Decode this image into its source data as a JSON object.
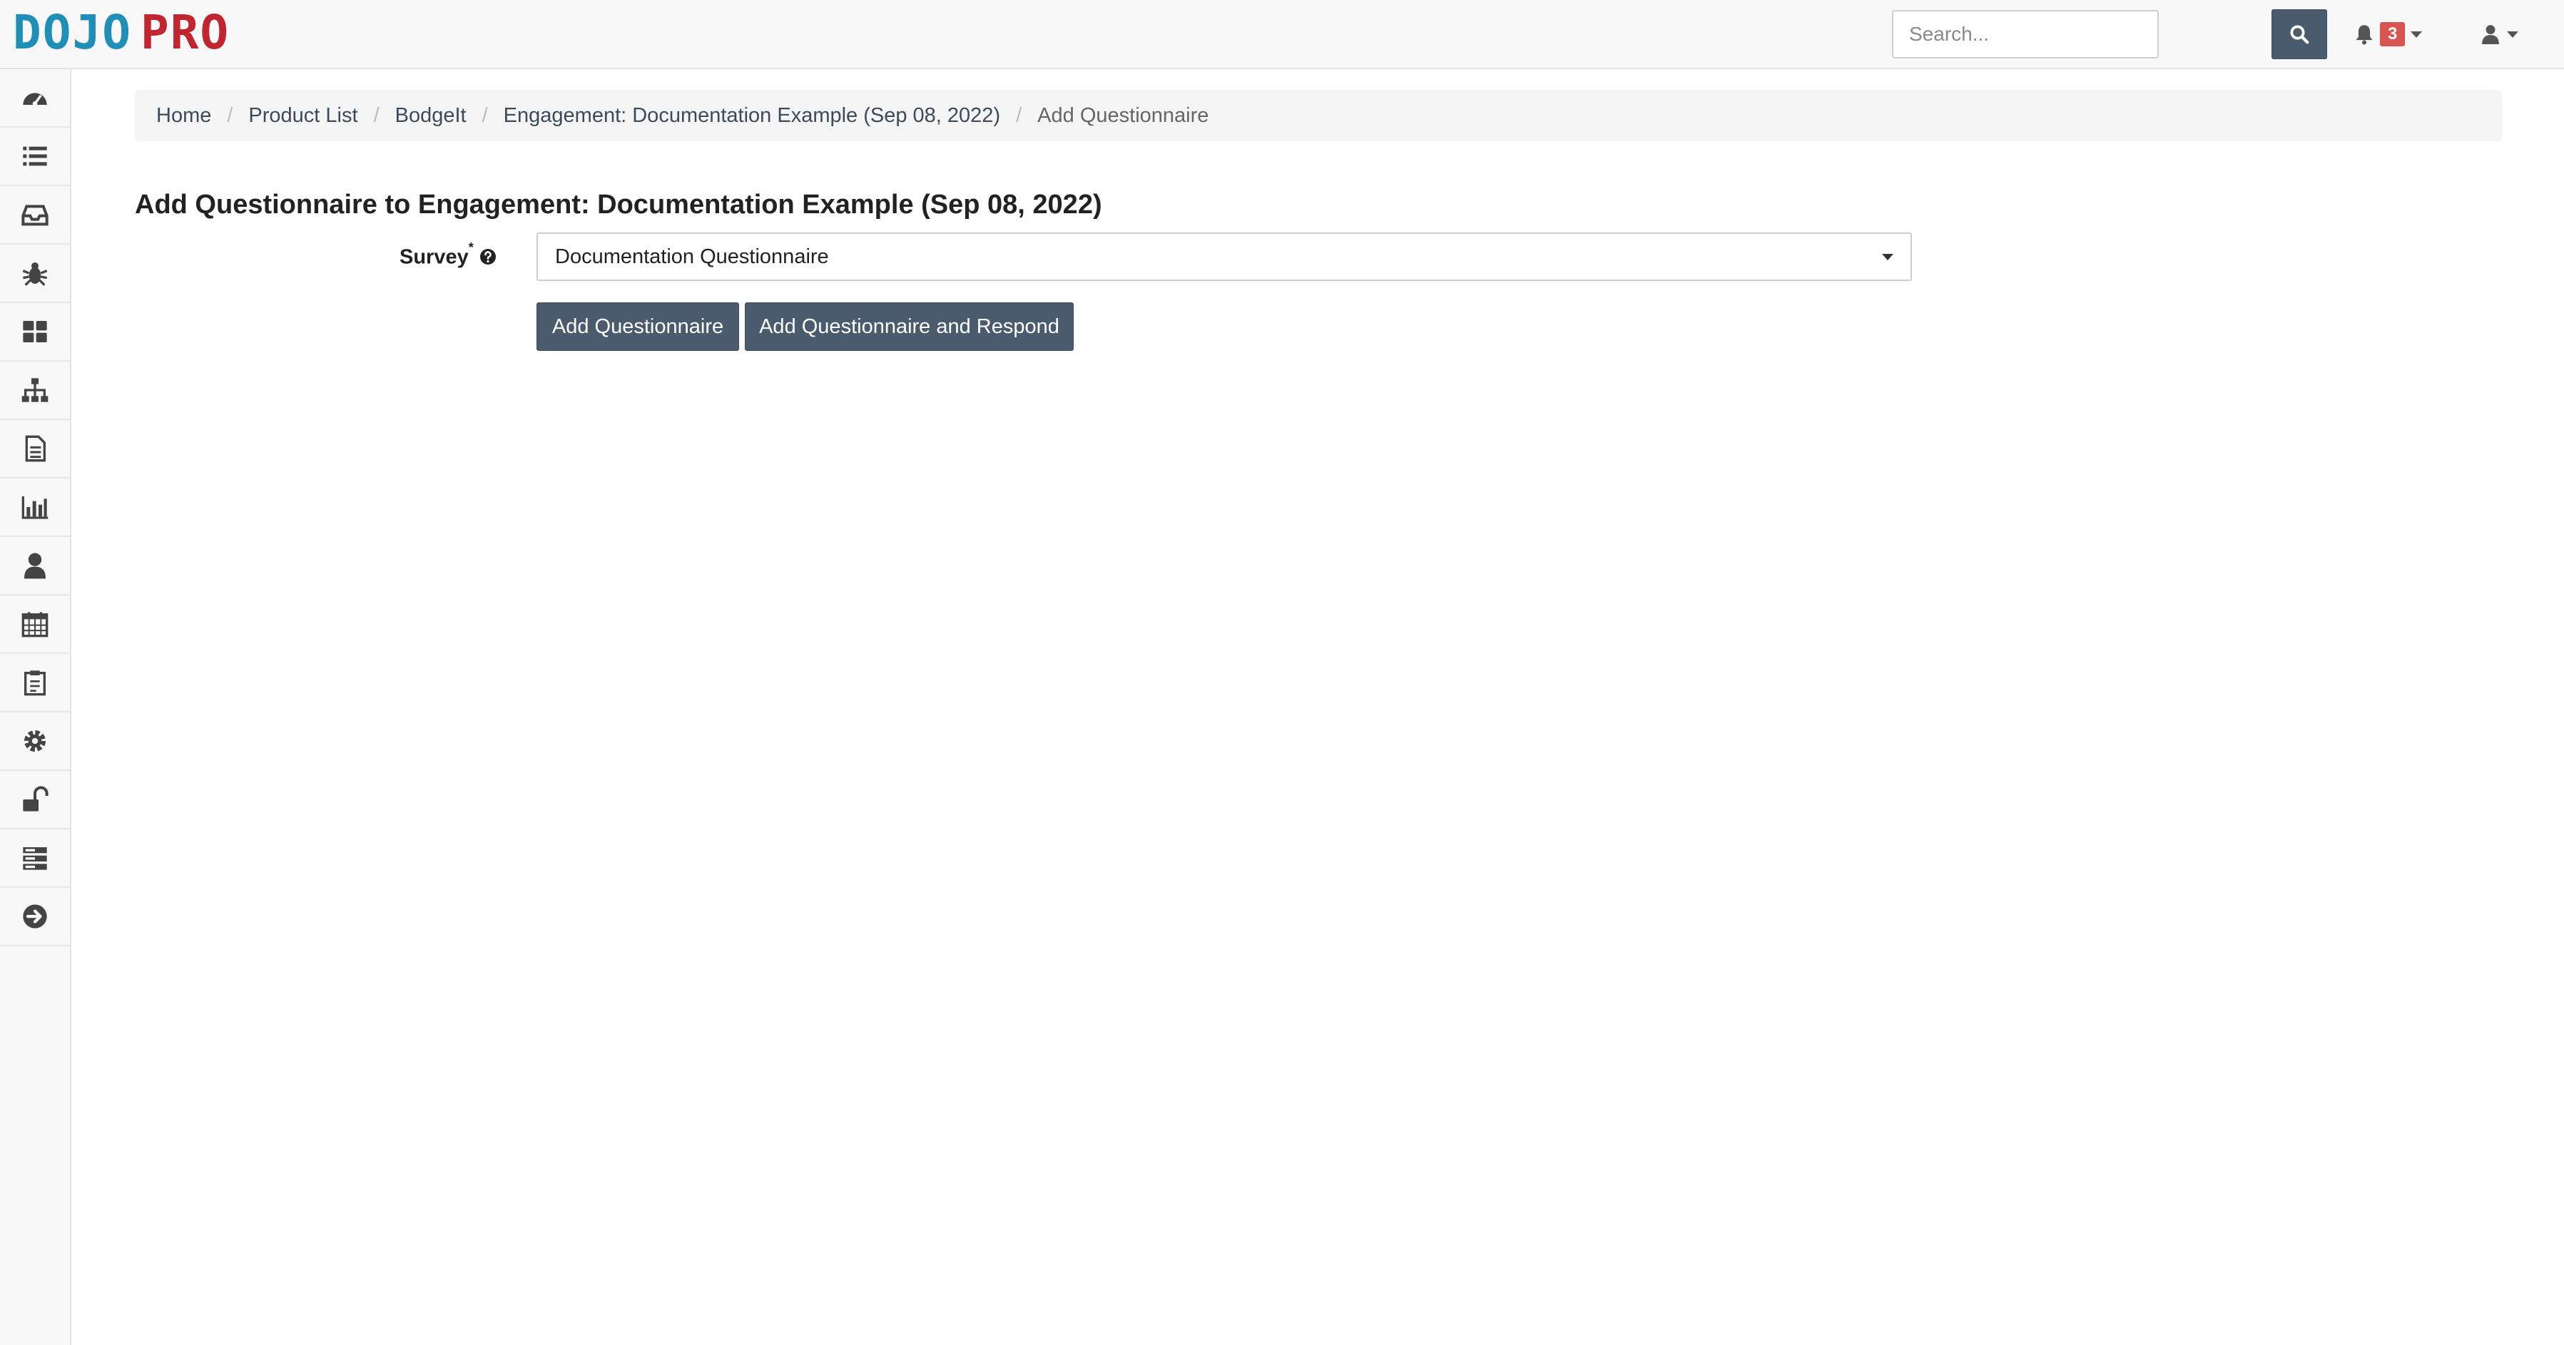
{
  "app": {
    "logo": {
      "part1": "DOJO",
      "part2": "PRO"
    },
    "colors": {
      "navbar": "#f8f8f8",
      "button": "#4a5b6d",
      "badge": "#d9534f",
      "logo_blue": "#1f8fb8",
      "logo_red": "#c0262f"
    }
  },
  "header": {
    "search_placeholder": "Search...",
    "notification_count": "3"
  },
  "sidebar": {
    "items": [
      {
        "icon": "dashboard-icon"
      },
      {
        "icon": "list-icon"
      },
      {
        "icon": "inbox-icon"
      },
      {
        "icon": "bug-icon"
      },
      {
        "icon": "grid-icon"
      },
      {
        "icon": "sitemap-icon"
      },
      {
        "icon": "document-icon"
      },
      {
        "icon": "bar-chart-icon"
      },
      {
        "icon": "user-icon"
      },
      {
        "icon": "calendar-icon"
      },
      {
        "icon": "clipboard-icon"
      },
      {
        "icon": "gear-icon"
      },
      {
        "icon": "unlock-icon"
      },
      {
        "icon": "server-icon"
      },
      {
        "icon": "arrow-circle-right-icon"
      }
    ]
  },
  "breadcrumb": [
    {
      "label": "Home"
    },
    {
      "label": "Product List"
    },
    {
      "label": "BodgeIt"
    },
    {
      "label": "Engagement: Documentation Example (Sep 08, 2022)"
    },
    {
      "label": "Add Questionnaire"
    }
  ],
  "main": {
    "title": "Add Questionnaire to Engagement: Documentation Example (Sep 08, 2022)",
    "survey": {
      "label": "Survey",
      "required_mark": "*",
      "selected": "Documentation Questionnaire"
    },
    "buttons": {
      "add": "Add Questionnaire",
      "add_respond": "Add Questionnaire and Respond"
    }
  }
}
